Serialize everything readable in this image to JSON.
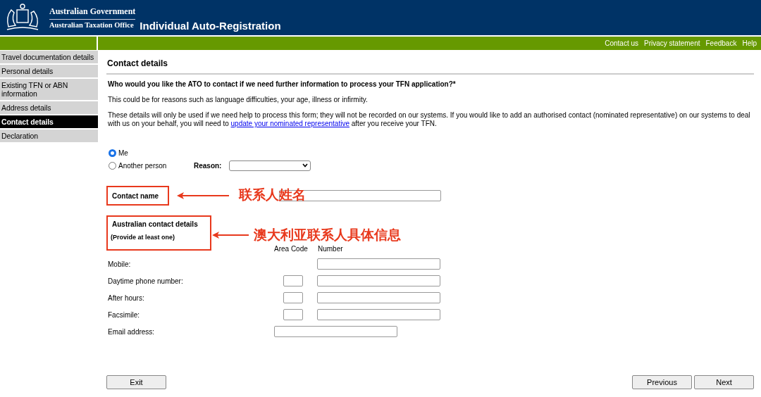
{
  "header": {
    "agency_lines": [
      "Australian Government",
      "Australian Taxation Office"
    ],
    "title": "Individual Auto-Registration"
  },
  "top_links": [
    "Contact us",
    "Privacy statement",
    "Feedback",
    "Help"
  ],
  "sidebar": {
    "items": [
      {
        "label": "Travel documentation details",
        "selected": false
      },
      {
        "label": "Personal details",
        "selected": false
      },
      {
        "label": "Existing TFN or ABN information",
        "selected": false
      },
      {
        "label": "Address details",
        "selected": false
      },
      {
        "label": "Contact details",
        "selected": true
      },
      {
        "label": "Declaration",
        "selected": false
      }
    ]
  },
  "page": {
    "heading": "Contact details",
    "question": "Who would you like the ATO to contact if we need further information to process your TFN application?*",
    "note": "This could be for reasons such as language difficulties, your age, illness or infirmity.",
    "details_before": "These details will only be used if we need help to process this form; they will not be recorded on our systems. If you would like to add an authorised contact (nominated representative) on our systems to deal with us on your behalf, you will need to ",
    "details_link": "update your nominated representative",
    "details_after": " after you receive your TFN."
  },
  "contact_choice": [
    {
      "label": "Me",
      "selected": true
    },
    {
      "label": "Another person",
      "selected": false
    }
  ],
  "reason": {
    "label": "Reason:"
  },
  "contact_name": {
    "label": "Contact name",
    "annotation": "联系人姓名"
  },
  "australian_details": {
    "title": "Australian contact details",
    "hint": "(Provide at least one)",
    "annotation": "澳大利亚联系人具体信息"
  },
  "phone_columns": [
    "Area Code",
    "Number"
  ],
  "phone_rows": [
    {
      "label": "Mobile:",
      "kind": "number"
    },
    {
      "label": "Daytime phone number:",
      "kind": "area_number"
    },
    {
      "label": "After hours:",
      "kind": "area_number"
    },
    {
      "label": "Facsimile:",
      "kind": "area_number"
    },
    {
      "label": "Email address:",
      "kind": "email"
    }
  ],
  "buttons": {
    "left": [
      "Exit"
    ],
    "right": [
      "Previous",
      "Next"
    ]
  }
}
